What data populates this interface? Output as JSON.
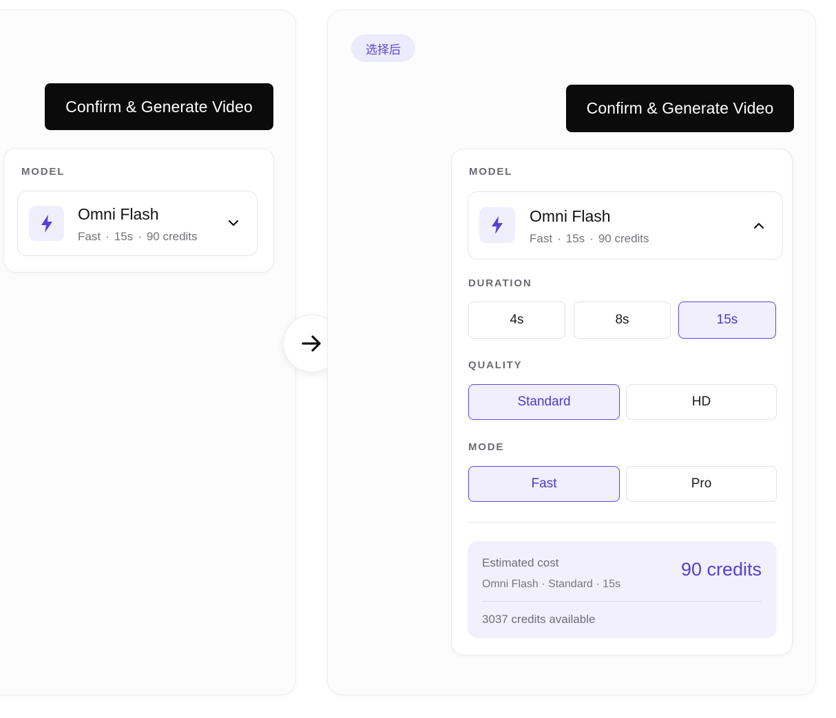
{
  "before": {
    "confirm_label": "Confirm & Generate Video",
    "model_section_label": "MODEL",
    "model": {
      "name": "Omni Flash",
      "speed": "Fast",
      "duration": "15s",
      "credits": "90 credits",
      "icon": "lightning-bolt-icon",
      "expanded": false
    }
  },
  "transition_icon": "arrow-right-icon",
  "after": {
    "tag": "选择后",
    "confirm_label": "Confirm & Generate Video",
    "model_section_label": "MODEL",
    "model": {
      "name": "Omni Flash",
      "speed": "Fast",
      "duration": "15s",
      "credits": "90 credits",
      "icon": "lightning-bolt-icon",
      "expanded": true
    },
    "duration": {
      "label": "DURATION",
      "options": [
        "4s",
        "8s",
        "15s"
      ],
      "selected": "15s"
    },
    "quality": {
      "label": "QUALITY",
      "options": [
        "Standard",
        "HD"
      ],
      "selected": "Standard"
    },
    "mode": {
      "label": "MODE",
      "options": [
        "Fast",
        "Pro"
      ],
      "selected": "Fast"
    },
    "cost": {
      "label": "Estimated cost",
      "summary": "Omni Flash · Standard · 15s",
      "value": "90 credits",
      "available": "3037 credits available"
    }
  },
  "colors": {
    "accent": "#5b47d8",
    "accent_bg": "#f1effd",
    "button_bg": "#0b0b0c"
  }
}
